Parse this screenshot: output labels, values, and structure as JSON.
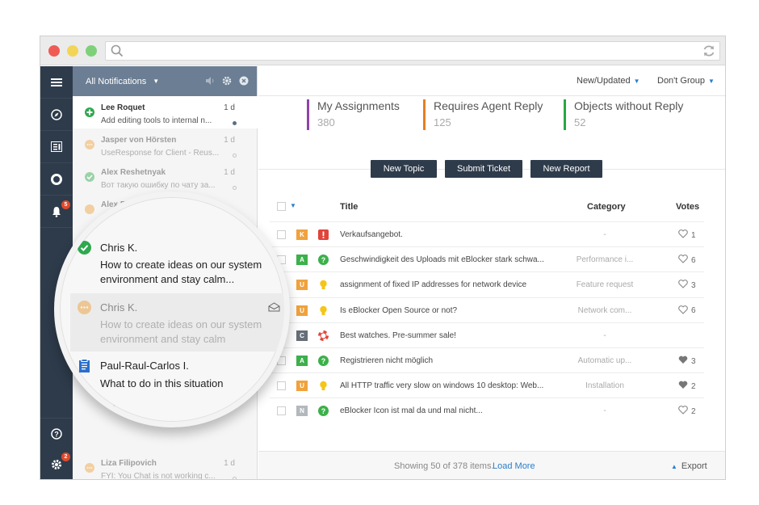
{
  "notifications": {
    "header": "All Notifications",
    "items": [
      {
        "name": "Lee Roquet",
        "time": "1 d",
        "text": "Add editing tools to internal n...",
        "icon": "plus",
        "dot": "filled",
        "faded": false
      },
      {
        "name": "Jasper von Hörsten",
        "time": "1 d",
        "text": "UseResponse for Client - Reus...",
        "icon": "chat",
        "dot": "hollow",
        "faded": true
      },
      {
        "name": "Alex Reshetnyak",
        "time": "1 d",
        "text": "Вот такую ошибку по чату за...",
        "icon": "check",
        "dot": "hollow",
        "faded": true
      },
      {
        "name": "Alex Reshetnyak",
        "time": "",
        "text": "",
        "icon": "chat",
        "dot": "",
        "faded": true
      },
      {
        "name": "Liza Filipovich",
        "time": "1 d",
        "text": "FYI: You Chat is not working c...",
        "icon": "chat",
        "dot": "hollow",
        "faded": true
      }
    ]
  },
  "rail": {
    "notifications_badge": "5",
    "settings_badge": "2"
  },
  "lens": {
    "items": [
      {
        "name": "Chris K.",
        "text": "How to create ideas on our system environment and stay calm...",
        "icon": "check"
      },
      {
        "name": "Chris K.",
        "text": "How to create ideas on our system environment and stay calm",
        "icon": "chat"
      },
      {
        "name": "Paul-Raul-Carlos I.",
        "text": "What to do in this situation",
        "icon": "clipboard"
      }
    ],
    "partial_text": "Use"
  },
  "main": {
    "sort_label": "New/Updated",
    "group_label": "Don't Group",
    "stats": [
      {
        "title": "My Assignments",
        "value": "380",
        "color": "#8e44ad"
      },
      {
        "title": "Requires Agent Reply",
        "value": "125",
        "color": "#e67e22"
      },
      {
        "title": "Objects without Reply",
        "value": "52",
        "color": "#27a844"
      }
    ],
    "buttons": {
      "new_topic": "New Topic",
      "submit_ticket": "Submit Ticket",
      "new_report": "New Report"
    },
    "columns": {
      "title": "Title",
      "category": "Category",
      "votes": "Votes"
    },
    "rows": [
      {
        "tag": "K",
        "tag_color": "#f0a23c",
        "type": "alert",
        "title": "Verkaufsangebot.",
        "category": "-",
        "votes": "1",
        "heart": "outline"
      },
      {
        "tag": "A",
        "tag_color": "#3cb04a",
        "type": "question",
        "title": "Geschwindigkeit des Uploads mit eBlocker stark schwa...",
        "category": "Performance i...",
        "votes": "6",
        "heart": "outline"
      },
      {
        "tag": "U",
        "tag_color": "#f0a23c",
        "type": "idea",
        "title": "assignment of fixed IP addresses for network device",
        "category": "Feature request",
        "votes": "3",
        "heart": "outline"
      },
      {
        "tag": "U",
        "tag_color": "#f0a23c",
        "type": "idea",
        "title": "Is eBlocker Open Source or not?",
        "category": "Network com...",
        "votes": "6",
        "heart": "outline"
      },
      {
        "tag": "C",
        "tag_color": "#666e78",
        "type": "help",
        "title": "Best watches. Pre-summer sale!",
        "category": "-",
        "votes": "",
        "heart": "none"
      },
      {
        "tag": "A",
        "tag_color": "#3cb04a",
        "type": "question",
        "title": "Registrieren nicht möglich",
        "category": "Automatic up...",
        "votes": "3",
        "heart": "filled"
      },
      {
        "tag": "U",
        "tag_color": "#f0a23c",
        "type": "idea",
        "title": "All HTTP traffic very slow on windows 10 desktop: Web...",
        "category": "Installation",
        "votes": "2",
        "heart": "filled"
      },
      {
        "tag": "N",
        "tag_color": "#b3b8bd",
        "type": "question",
        "title": "eBlocker Icon ist mal da und mal nicht...",
        "category": "-",
        "votes": "2",
        "heart": "outline"
      }
    ],
    "footer": {
      "showing": "Showing 50 of 378 items.",
      "load_more": "Load More",
      "export": "Export"
    }
  }
}
